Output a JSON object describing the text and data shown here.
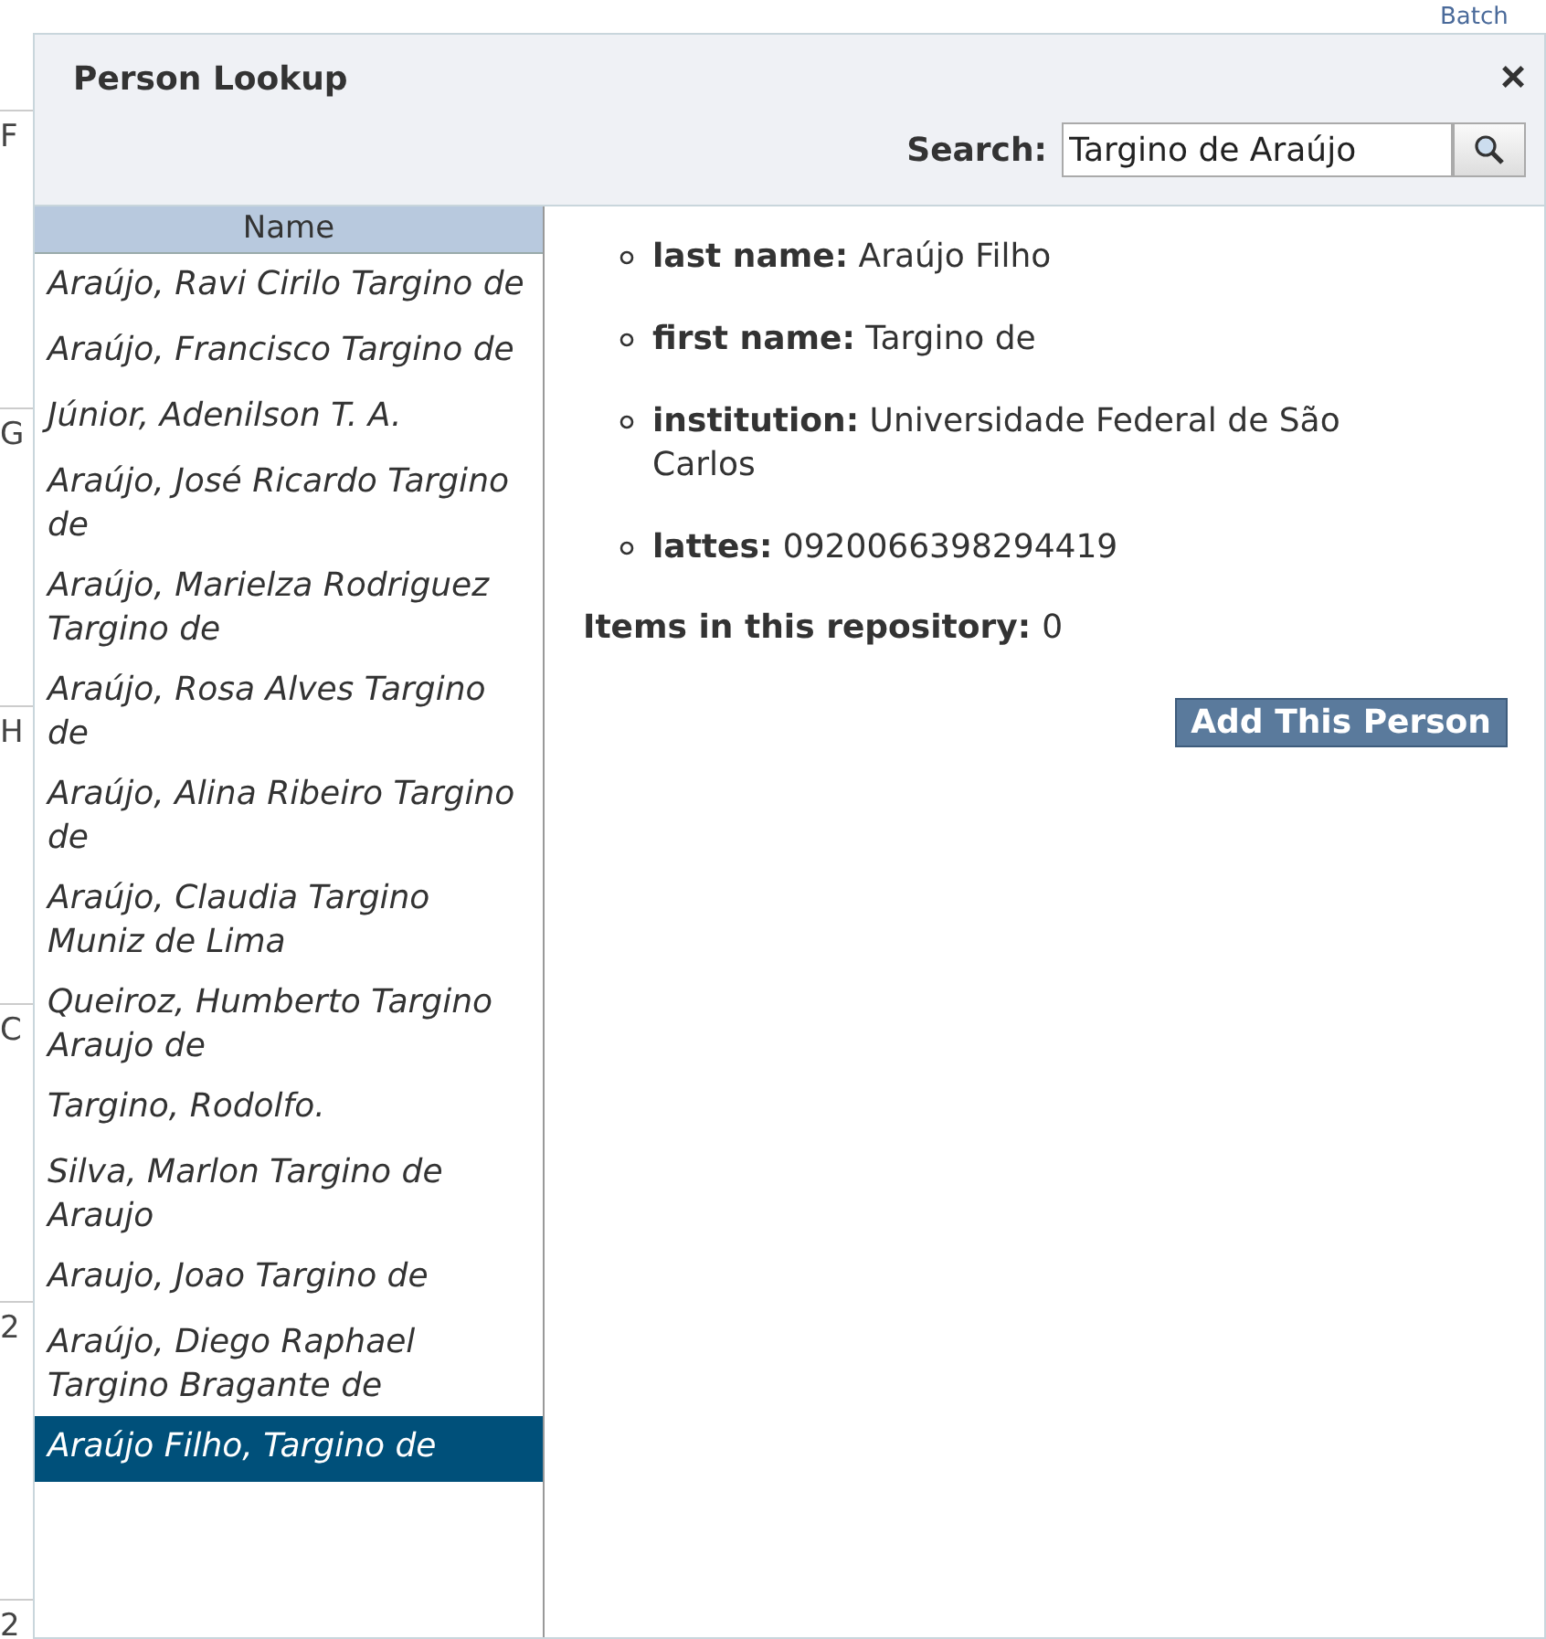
{
  "background": {
    "top_link": "Batch",
    "row_labels": [
      "F",
      "G",
      "H",
      "C",
      "2",
      "2"
    ]
  },
  "dialog": {
    "title": "Person Lookup",
    "close": "×",
    "search": {
      "label": "Search:",
      "value": "Targino de Araújo"
    },
    "list": {
      "heading": "Name",
      "items": [
        {
          "name": "Araújo, Ravi Cirilo Targino de",
          "selected": false
        },
        {
          "name": "Araújo, Francisco Targino de",
          "selected": false
        },
        {
          "name": "Júnior, Adenilson T. A.",
          "selected": false
        },
        {
          "name": "Araújo, José Ricardo Targino de",
          "selected": false
        },
        {
          "name": "Araújo, Marielza Rodriguez Targino de",
          "selected": false
        },
        {
          "name": "Araújo, Rosa Alves Targino de",
          "selected": false
        },
        {
          "name": "Araújo, Alina Ribeiro Targino de",
          "selected": false
        },
        {
          "name": "Araújo, Claudia Targino Muniz de Lima",
          "selected": false
        },
        {
          "name": "Queiroz, Humberto Targino Araujo de",
          "selected": false
        },
        {
          "name": "Targino, Rodolfo.",
          "selected": false
        },
        {
          "name": "Silva, Marlon Targino de Araujo",
          "selected": false
        },
        {
          "name": "Araujo, Joao Targino de",
          "selected": false
        },
        {
          "name": "Araújo, Diego Raphael Targino Bragante de",
          "selected": false
        },
        {
          "name": "Araújo Filho, Targino de",
          "selected": true
        }
      ]
    },
    "details": {
      "fields": [
        {
          "label": "last name:",
          "value": "Araújo Filho"
        },
        {
          "label": "first name:",
          "value": "Targino de"
        },
        {
          "label": "institution:",
          "value": "Universidade Federal de São Carlos"
        },
        {
          "label": "lattes:",
          "value": "0920066398294419"
        }
      ],
      "items_label": "Items in this repository:",
      "items_count": "0",
      "add_button": "Add This Person"
    }
  }
}
